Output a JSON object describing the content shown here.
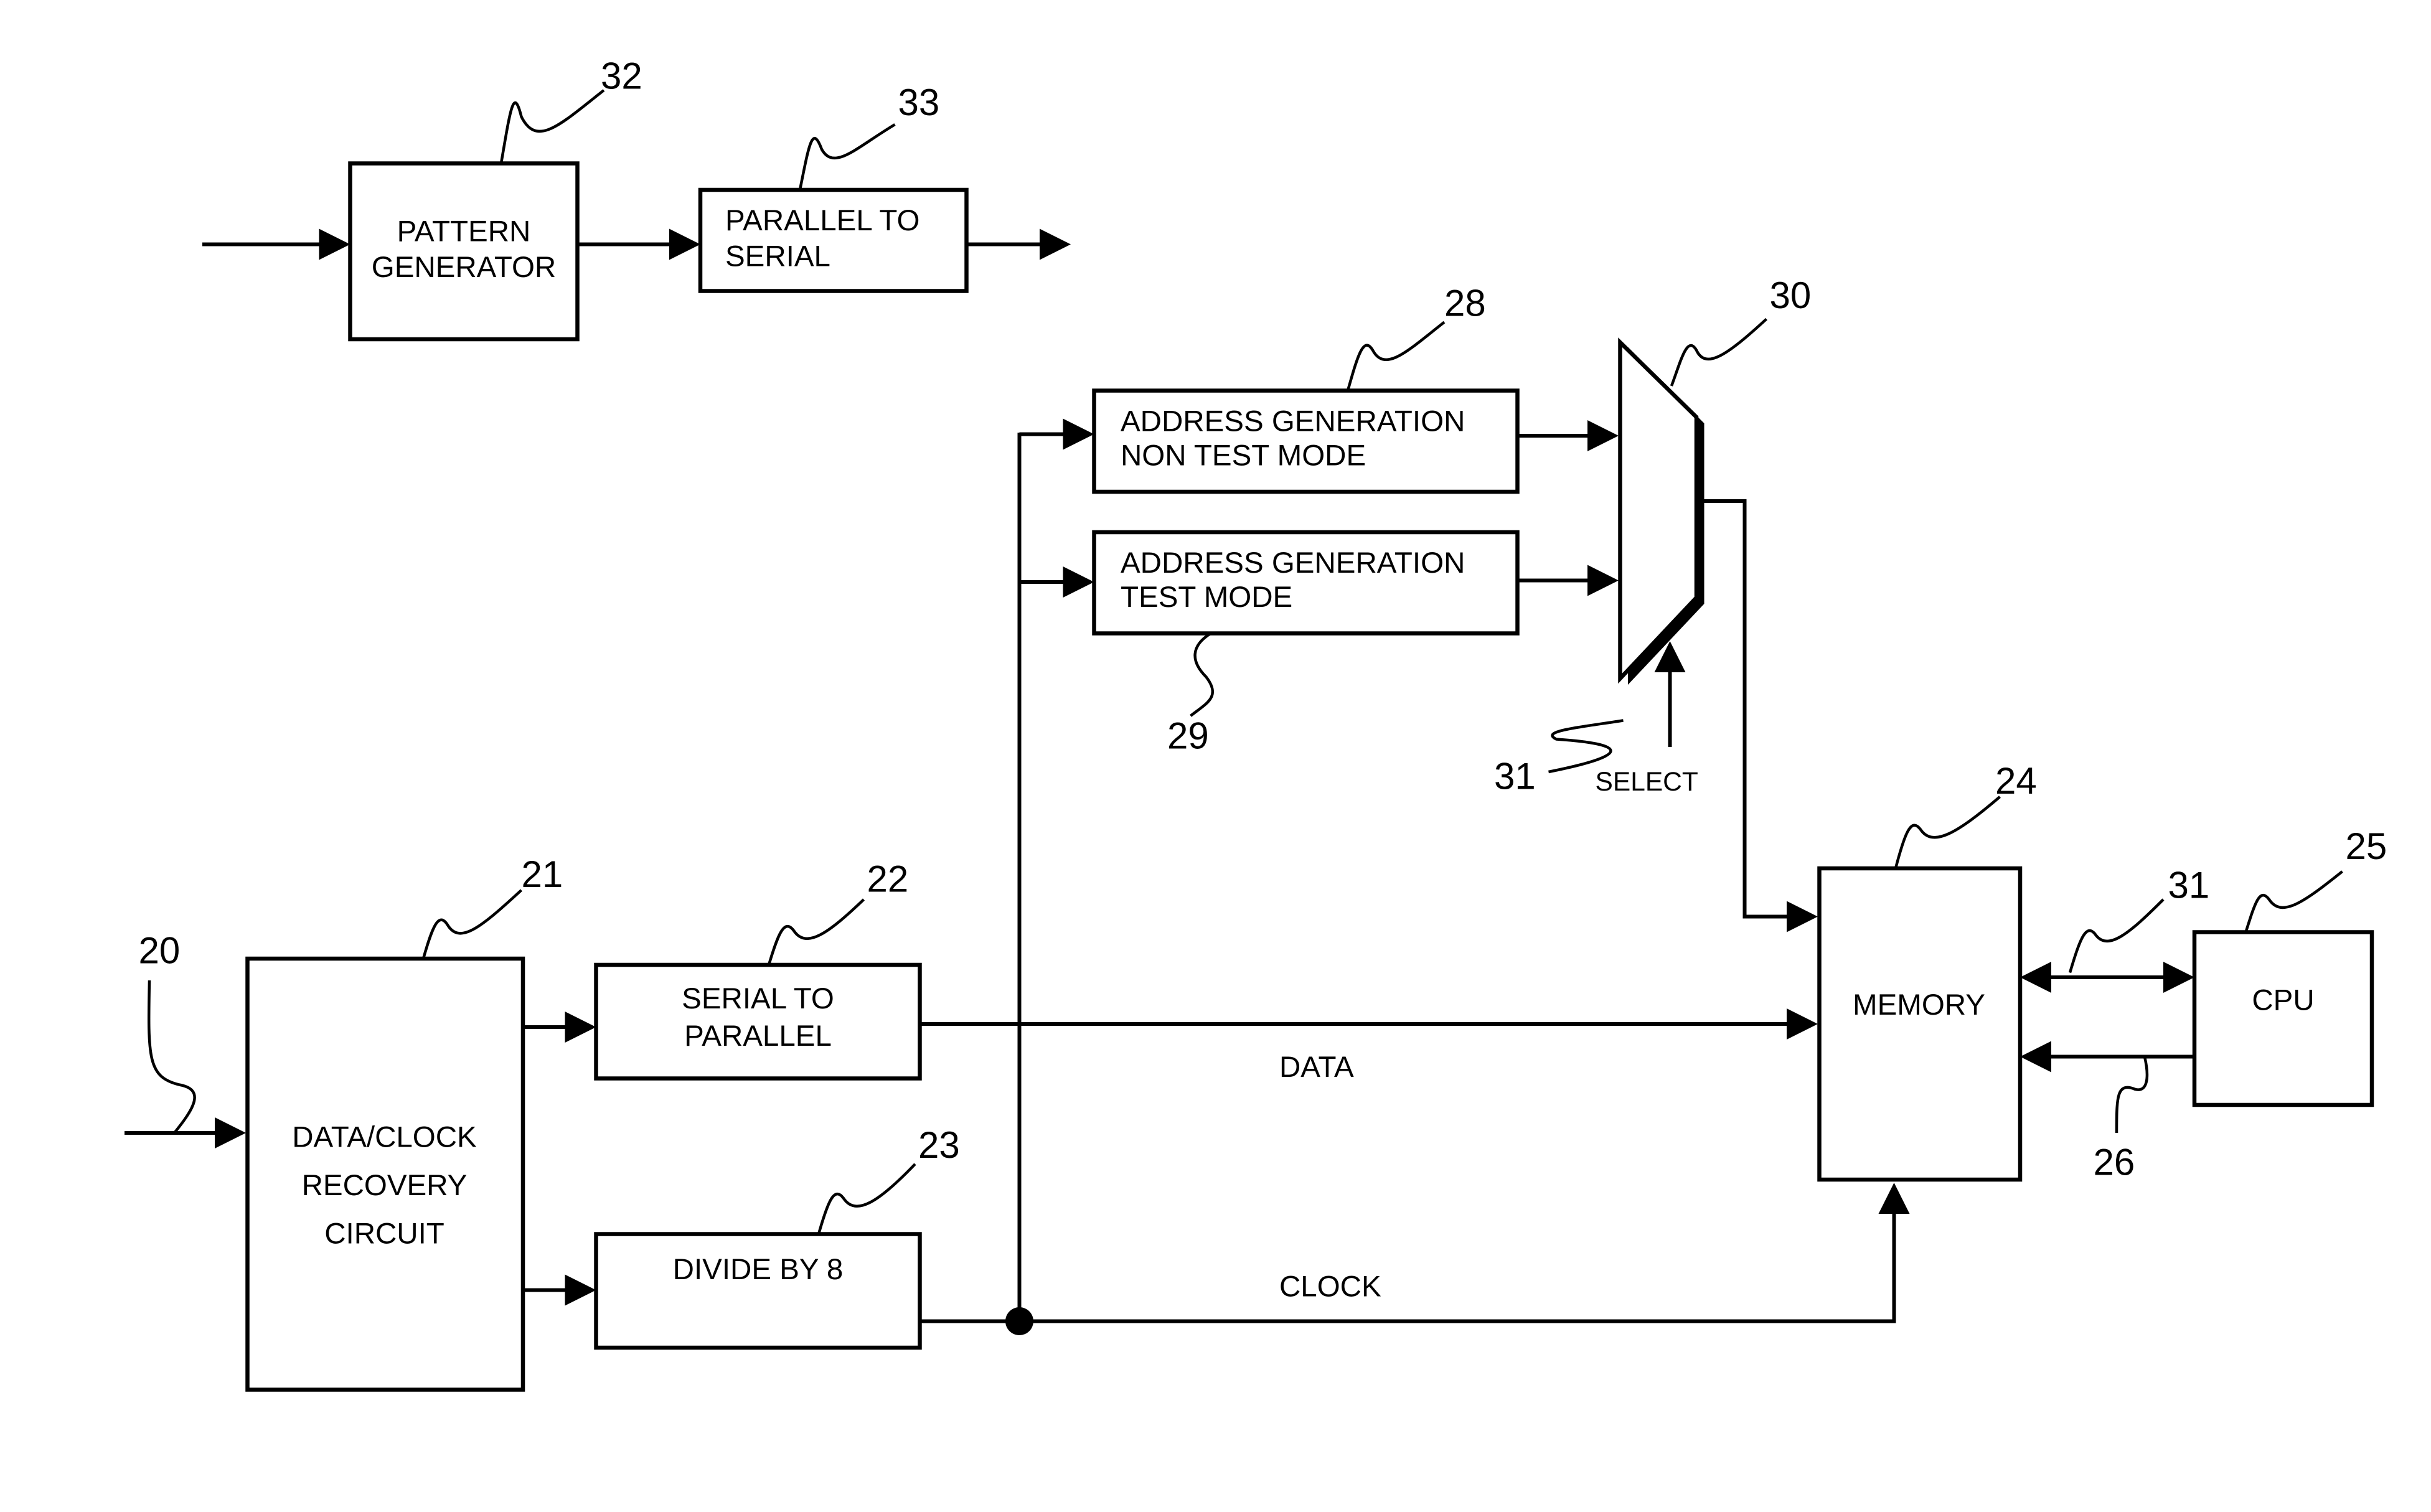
{
  "blocks": {
    "pattern_generator": {
      "ref": "32",
      "lines": [
        "PATTERN",
        "GENERATOR"
      ]
    },
    "parallel_to_serial": {
      "ref": "33",
      "lines": [
        "PARALLEL TO",
        "SERIAL"
      ]
    },
    "addr_gen_non_test": {
      "ref": "28",
      "lines": [
        "ADDRESS GENERATION",
        "NON TEST MODE"
      ]
    },
    "addr_gen_test": {
      "ref": "29",
      "lines": [
        "ADDRESS GENERATION",
        "TEST MODE"
      ]
    },
    "mux": {
      "ref": "30"
    },
    "select": {
      "ref": "31",
      "label": "SELECT"
    },
    "data_clock_recovery": {
      "ref": "21",
      "lines": [
        "DATA/CLOCK",
        "RECOVERY",
        "CIRCUIT"
      ]
    },
    "serial_to_parallel": {
      "ref": "22",
      "lines": [
        "SERIAL TO",
        "PARALLEL"
      ]
    },
    "divide_by_8": {
      "ref": "23",
      "lines": [
        "DIVIDE BY 8"
      ]
    },
    "memory": {
      "ref": "24",
      "lines": [
        "MEMORY"
      ]
    },
    "cpu": {
      "ref": "25",
      "lines": [
        "CPU"
      ]
    }
  },
  "signals": {
    "input_ref": "20",
    "data_label": "DATA",
    "clock_label": "CLOCK",
    "bus_ref": "31",
    "cpu_to_mem_ref": "26"
  }
}
